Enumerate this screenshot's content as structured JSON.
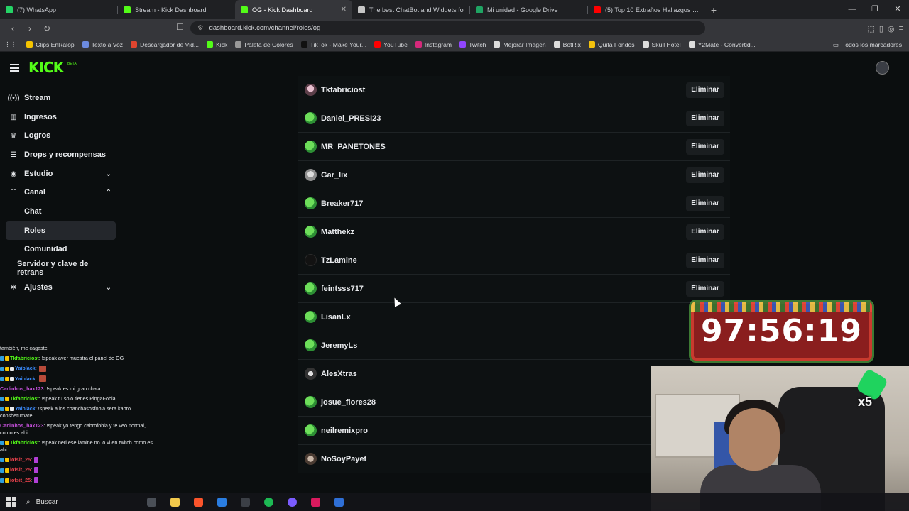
{
  "browser": {
    "tabs": [
      {
        "title": "(7) WhatsApp",
        "color": "#25d366",
        "active": false
      },
      {
        "title": "Stream - Kick Dashboard",
        "color": "#53fc18",
        "active": false
      },
      {
        "title": "OG - Kick Dashboard",
        "color": "#53fc18",
        "active": true
      },
      {
        "title": "The best ChatBot and Widgets fo",
        "color": "#c6c6c6",
        "active": false
      },
      {
        "title": "Mi unidad - Google Drive",
        "color": "#1fa463",
        "active": false
      },
      {
        "title": "(5) Top 10 Extraños Hallazgos En La",
        "color": "#ff0000",
        "active": false
      }
    ],
    "url": "dashboard.kick.com/channel/roles/og",
    "bookmarks": [
      {
        "label": "Clips EnRalop",
        "color": "#f5c400"
      },
      {
        "label": "Texto a Voz",
        "color": "#6c8be0"
      },
      {
        "label": "Descargador de Vid...",
        "color": "#e0452f"
      },
      {
        "label": "Kick",
        "color": "#53fc18"
      },
      {
        "label": "Paleta de Colores",
        "color": "#999999"
      },
      {
        "label": "TikTok - Make Your...",
        "color": "#111111"
      },
      {
        "label": "YouTube",
        "color": "#ff0000"
      },
      {
        "label": "Instagram",
        "color": "#d6297b"
      },
      {
        "label": "Twitch",
        "color": "#9146ff"
      },
      {
        "label": "Mejorar Imagen",
        "color": "#dddddd"
      },
      {
        "label": "BotRix",
        "color": "#dddddd"
      },
      {
        "label": "Quita Fondos",
        "color": "#f4c20d"
      },
      {
        "label": "Skull Hotel",
        "color": "#dddddd"
      },
      {
        "label": "Y2Mate - Convertid...",
        "color": "#dddddd"
      }
    ],
    "all_bookmarks": "Todos los marcadores"
  },
  "sidebar": {
    "items": [
      {
        "label": "Stream",
        "icon": "broadcast-icon",
        "glyph": "((•))"
      },
      {
        "label": "Ingresos",
        "icon": "chart-icon",
        "glyph": "▥"
      },
      {
        "label": "Logros",
        "icon": "trophy-icon",
        "glyph": "♛"
      },
      {
        "label": "Drops y recompensas",
        "icon": "gift-icon",
        "glyph": "☰"
      },
      {
        "label": "Estudio",
        "icon": "studio-icon",
        "glyph": "◉"
      },
      {
        "label": "Canal",
        "icon": "channel-icon",
        "glyph": "☷"
      },
      {
        "label": "Chat"
      },
      {
        "label": "Roles"
      },
      {
        "label": "Comunidad"
      },
      {
        "label": "Servidor y clave de retrans"
      },
      {
        "label": "Ajustes",
        "icon": "gear-icon",
        "glyph": "✲"
      }
    ]
  },
  "roles": {
    "delete_label": "Eliminar",
    "users": [
      {
        "name": "Tkfabriciost",
        "avatar": "pink",
        "has_delete": true
      },
      {
        "name": "Daniel_PRESI23",
        "avatar": "green",
        "has_delete": true
      },
      {
        "name": "MR_PANETONES",
        "avatar": "green",
        "has_delete": true
      },
      {
        "name": "Gar_lix",
        "avatar": "grey",
        "has_delete": true
      },
      {
        "name": "Breaker717",
        "avatar": "green",
        "has_delete": true
      },
      {
        "name": "Matthekz",
        "avatar": "green",
        "has_delete": true
      },
      {
        "name": "TzLamine",
        "avatar": "dark",
        "has_delete": true
      },
      {
        "name": "feintsss717",
        "avatar": "green",
        "has_delete": true
      },
      {
        "name": "LisanLx",
        "avatar": "green",
        "has_delete": false
      },
      {
        "name": "JeremyLs",
        "avatar": "green",
        "has_delete": false
      },
      {
        "name": "AlesXtras",
        "avatar": "bw",
        "has_delete": false
      },
      {
        "name": "josue_flores28",
        "avatar": "green",
        "has_delete": false
      },
      {
        "name": "neilremixpro",
        "avatar": "green",
        "has_delete": false
      },
      {
        "name": "NoSoyPayet",
        "avatar": "brown",
        "has_delete": false
      }
    ]
  },
  "chat": {
    "lines": [
      {
        "user": "",
        "color": "#e8eaed",
        "text": "también, me cagaste",
        "badges": 0,
        "wrap": false,
        "emote": ""
      },
      {
        "user": "Tkfabriciost",
        "color": "#53fc18",
        "text": ": !speak aver muestra el panel de OG",
        "badges": 2,
        "wrap": false,
        "emote": ""
      },
      {
        "user": "Yaiblack",
        "color": "#3b8cff",
        "text": ":",
        "badges": 3,
        "wrap": false,
        "emote": "red"
      },
      {
        "user": "Yaiblack",
        "color": "#3b8cff",
        "text": ":",
        "badges": 3,
        "wrap": false,
        "emote": "red"
      },
      {
        "user": "Carlinhos_hax123",
        "color": "#c14fd6",
        "text": ": !speak es mi gran chala",
        "badges": 0,
        "wrap": false,
        "emote": ""
      },
      {
        "user": "Tkfabriciost",
        "color": "#53fc18",
        "text": ": !speak tu solo tienes PingaFobia",
        "badges": 2,
        "wrap": false,
        "emote": ""
      },
      {
        "user": "Yaiblack",
        "color": "#3b8cff",
        "text": ": !speak a los chanchasosfobia sera kabro conshetumare",
        "badges": 3,
        "wrap": true,
        "emote": ""
      },
      {
        "user": "Carlinhos_hax123",
        "color": "#c14fd6",
        "text": ": !speak yo tengo cabrofobia y te veo normal, como es ahi",
        "badges": 0,
        "wrap": true,
        "emote": ""
      },
      {
        "user": "Tkfabriciost",
        "color": "#53fc18",
        "text": ": !speak neri ese lamine no lo vi en twitch como es ahi",
        "badges": 2,
        "wrap": true,
        "emote": ""
      },
      {
        "user": "iofsit_25",
        "color": "#e8414b",
        "text": ":",
        "badges": 2,
        "wrap": false,
        "emote": "pur"
      },
      {
        "user": "iofsit_25",
        "color": "#e8414b",
        "text": ":",
        "badges": 2,
        "wrap": false,
        "emote": "pur"
      },
      {
        "user": "iofsit_25",
        "color": "#e8414b",
        "text": ":",
        "badges": 2,
        "wrap": false,
        "emote": "pur"
      }
    ]
  },
  "overlay": {
    "timer": "97:56:19",
    "multiplier": "x5"
  },
  "taskbar": {
    "search_label": "Buscar"
  }
}
